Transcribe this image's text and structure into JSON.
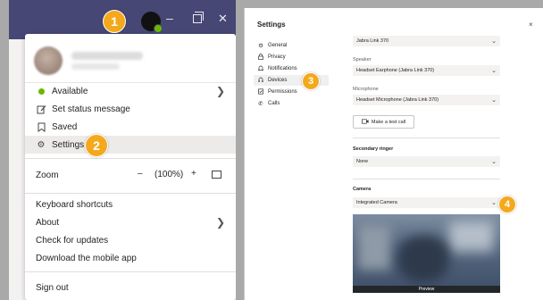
{
  "teams_window": {
    "controls": {
      "minimize": "–",
      "close": "✕"
    }
  },
  "profile_menu": {
    "status": {
      "label": "Available",
      "color": "#6bb700"
    },
    "status_message": "Set status message",
    "saved": "Saved",
    "settings": "Settings",
    "zoom": {
      "label": "Zoom",
      "minus": "–",
      "value": "(100%)",
      "plus": "+"
    },
    "keyboard_shortcuts": "Keyboard shortcuts",
    "about": "About",
    "check_updates": "Check for updates",
    "download_app": "Download the mobile app",
    "sign_out": "Sign out"
  },
  "settings": {
    "title": "Settings",
    "close": "×",
    "nav": [
      {
        "label": "General",
        "icon": "gear-icon"
      },
      {
        "label": "Privacy",
        "icon": "lock-icon"
      },
      {
        "label": "Notifications",
        "icon": "bell-icon"
      },
      {
        "label": "Devices",
        "icon": "headset-icon"
      },
      {
        "label": "Permissions",
        "icon": "permissions-icon"
      },
      {
        "label": "Calls",
        "icon": "phone-icon"
      }
    ],
    "devices": {
      "audio_device": "Jabra Link 370",
      "speaker_label": "Speaker",
      "speaker_value": "Headset Earphone (Jabra Link 370)",
      "microphone_label": "Microphone",
      "microphone_value": "Headset Microphone (Jabra Link 370)",
      "test_call": "Make a test call",
      "secondary_ringer_label": "Secondary ringer",
      "secondary_ringer_value": "None",
      "camera_label": "Camera",
      "camera_value": "Integrated Camera",
      "preview_label": "Preview"
    }
  },
  "steps": [
    "1",
    "2",
    "3",
    "4"
  ],
  "colors": {
    "titlebar": "#464775",
    "badge": "#f4a91d",
    "available": "#6bb700"
  }
}
